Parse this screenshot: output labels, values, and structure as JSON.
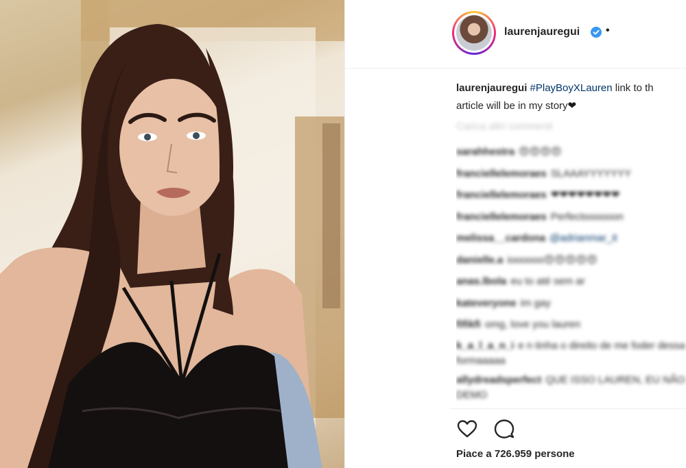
{
  "post": {
    "photo_alt": "",
    "author": {
      "username": "laurenjauregui",
      "verified": true,
      "separator": "•"
    },
    "caption": {
      "username": "laurenjauregui",
      "hashtag": "#PlayBoyXLauren",
      "text_line1": " link to th",
      "text_line2": "article will be in my story",
      "emoji": "❤"
    },
    "load_more_label": "Carica altri commenti",
    "comments": [
      {
        "user": "sarahhestra",
        "text": "😍😍😍😍"
      },
      {
        "user": "franciellelemoraes",
        "text": "SLAAAYYYYYYY"
      },
      {
        "user": "franciellelemoraes",
        "text": "❤❤❤❤❤❤❤❤"
      },
      {
        "user": "franciellelemoraes",
        "text": "Perfectoooooon"
      },
      {
        "user": "melissa__cardona",
        "text": "@adrianmar_it",
        "mention": true
      },
      {
        "user": "danielle.a",
        "text": "ioooooo😍😍😍😍😍"
      },
      {
        "user": "anas.lbola",
        "text": "eu to até sem ar"
      },
      {
        "user": "kateveryone",
        "text": "im gay"
      },
      {
        "user": "fifikfi",
        "text": "omg, love you lauren"
      },
      {
        "user": "k_a_l_a_n_i",
        "text": "e n tinha o direito de me foder dessa formaaaaa",
        "two_line": true
      },
      {
        "user": "allydreadsperfect",
        "text": "QUE ISSO LAUREN, EU NÃO DEMO",
        "two_line": true
      }
    ],
    "actions": {
      "like_icon": "heart-icon",
      "comment_icon": "comment-icon"
    },
    "likes_text": "Piace a 726.959 persone"
  },
  "colors": {
    "text": "#262626",
    "link": "#003569",
    "muted": "#c7c7c7",
    "verified": "#3897f0",
    "border": "#efefef"
  }
}
